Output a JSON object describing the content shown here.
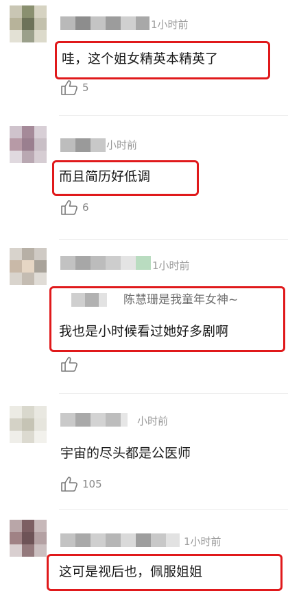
{
  "comments": [
    {
      "time": "1小时前",
      "text": "哇，这个姐女精英本精英了",
      "likes": "5"
    },
    {
      "time": "小时前",
      "text": "而且简历好低调",
      "likes": "6"
    },
    {
      "time": "1小时前",
      "reply_quote": "陈慧珊是我童年女神~",
      "text": "我也是小时候看过她好多剧啊",
      "likes": ""
    },
    {
      "time": "小时前",
      "text": "宇宙的尽头都是公医师",
      "likes": "105"
    },
    {
      "time": "1小时前",
      "text": "这可是视后也，佩服姐姐"
    }
  ],
  "icons": {
    "like": "thumbs-up-icon"
  },
  "colors": {
    "highlight": "#e0191b",
    "muted_text": "#9a9a9a"
  }
}
